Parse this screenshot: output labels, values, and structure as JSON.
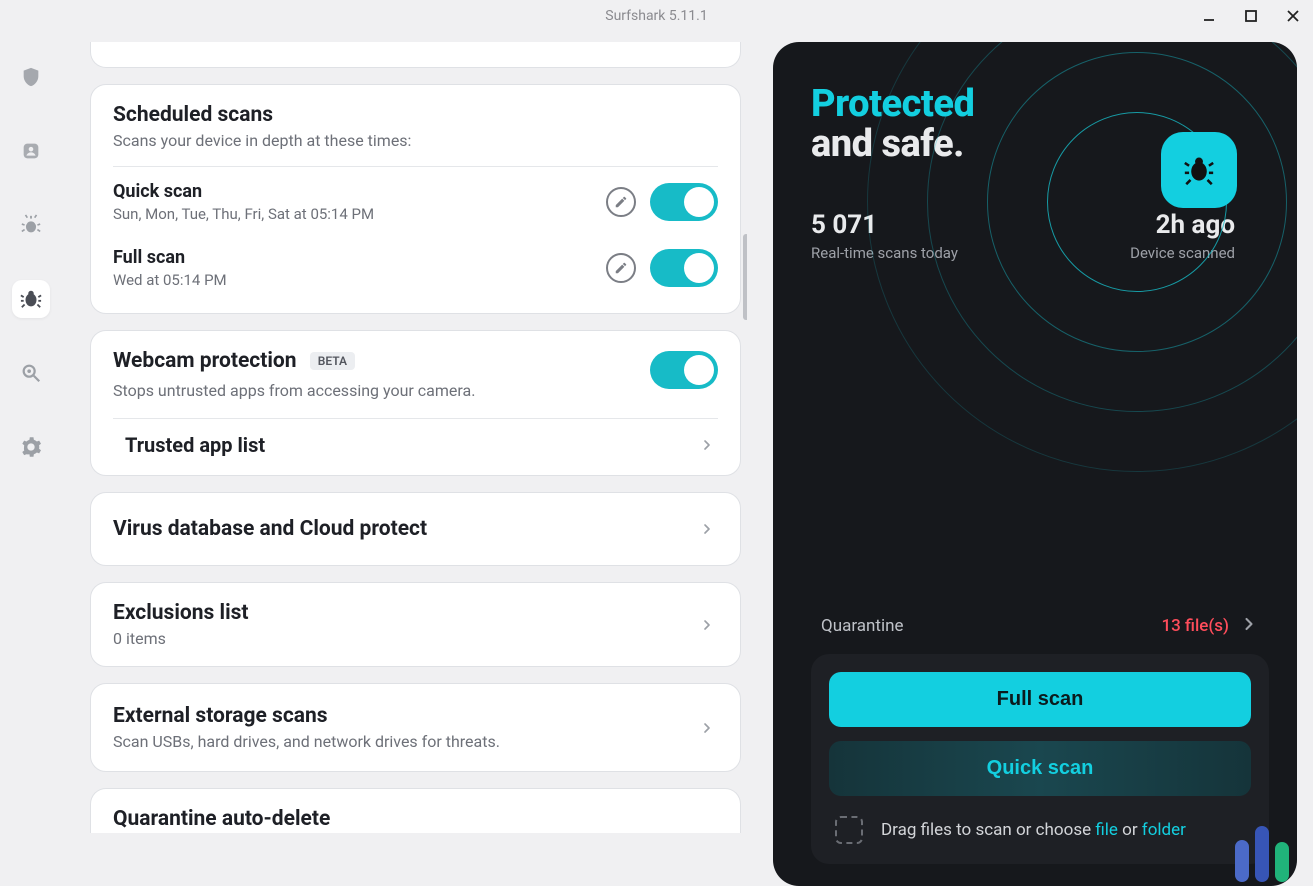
{
  "window": {
    "title": "Surfshark 5.11.1"
  },
  "sidebar": {
    "items": [
      {
        "name": "shield-icon"
      },
      {
        "name": "user-icon"
      },
      {
        "name": "alert-icon"
      },
      {
        "name": "bug-icon",
        "active": true
      },
      {
        "name": "search-icon"
      },
      {
        "name": "gear-icon"
      }
    ]
  },
  "settings": {
    "scheduled": {
      "title": "Scheduled scans",
      "subtitle": "Scans your device in depth at these times:",
      "quick": {
        "title": "Quick scan",
        "subtitle": "Sun, Mon, Tue, Thu, Fri, Sat at 05:14 PM",
        "enabled": true
      },
      "full": {
        "title": "Full scan",
        "subtitle": "Wed at 05:14 PM",
        "enabled": true
      }
    },
    "webcam": {
      "title": "Webcam protection",
      "badge": "BETA",
      "subtitle": "Stops untrusted apps from accessing your camera.",
      "enabled": true,
      "trusted_label": "Trusted app list"
    },
    "virus_db": {
      "title": "Virus database and Cloud protect"
    },
    "exclusions": {
      "title": "Exclusions list",
      "subtitle": "0 items"
    },
    "external_storage": {
      "title": "External storage scans",
      "subtitle": "Scan USBs, hard drives, and network drives for threats."
    },
    "quarantine_auto_delete": {
      "title": "Quarantine auto-delete"
    }
  },
  "status": {
    "hero1": "Protected",
    "hero2": "and safe.",
    "scans_today": {
      "value": "5 071",
      "label": "Real-time scans today"
    },
    "last_scan": {
      "value": "2h ago",
      "label": "Device scanned"
    },
    "quarantine": {
      "label": "Quarantine",
      "count": "13 file(s)"
    },
    "full_scan_btn": "Full scan",
    "quick_scan_btn": "Quick scan",
    "drop": {
      "prefix": "Drag files to scan or choose ",
      "file": "file",
      "middle": " or ",
      "folder": "folder"
    }
  }
}
